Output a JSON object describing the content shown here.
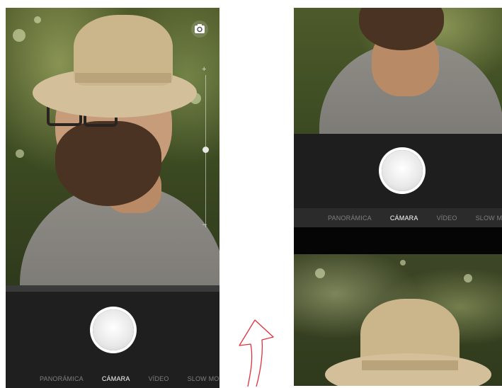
{
  "left_phone": {
    "modes": [
      {
        "label": "PANORÁMICA",
        "active": false
      },
      {
        "label": "CÁMARA",
        "active": true
      },
      {
        "label": "VÍDEO",
        "active": false
      },
      {
        "label": "SLOW MOTIO",
        "active": false
      }
    ],
    "zoom": {
      "plus": "+",
      "minus": "–",
      "level": 0.5
    },
    "switch_camera_icon": "camera-switch-icon"
  },
  "right_phone": {
    "modes": [
      {
        "label": "PANORÁMICA",
        "active": false
      },
      {
        "label": "CÁMARA",
        "active": true
      },
      {
        "label": "VÍDEO",
        "active": false
      },
      {
        "label": "SLOW MOTI",
        "active": false
      }
    ]
  },
  "arrow": {
    "icon": "up-arrow-icon",
    "color": "#e0313f"
  },
  "colors": {
    "controls_bg": "#1f1f1f",
    "active_mode": "#ffffff",
    "inactive_mode": "#7f7f7f"
  }
}
